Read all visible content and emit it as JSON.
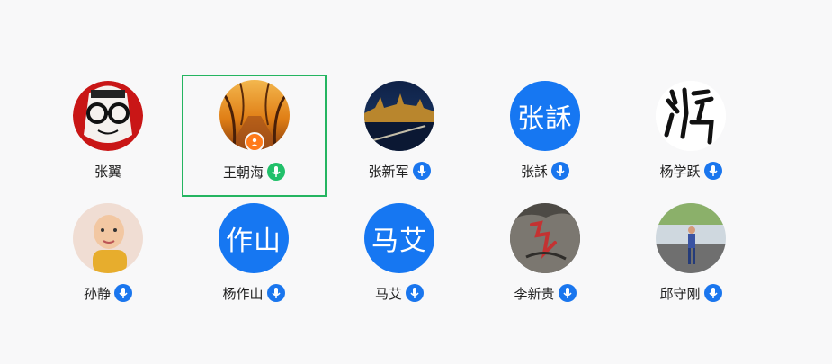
{
  "participants": [
    {
      "name": "张翼",
      "avatar": "cartoon-avatar",
      "mic": null,
      "selected": false
    },
    {
      "name": "王朝海",
      "avatar": "autumn-tree-avatar",
      "mic": "green",
      "selected": true,
      "role_badge": "person-icon"
    },
    {
      "name": "张新军",
      "avatar": "city-night-avatar",
      "mic": "blue",
      "selected": false
    },
    {
      "name": "张訸",
      "avatar_text": "张訸",
      "mic": "blue",
      "selected": false
    },
    {
      "name": "杨学跃",
      "avatar": "calligraphy-avatar",
      "mic": "blue",
      "selected": false
    },
    {
      "name": "孙静",
      "avatar": "baby-photo-avatar",
      "mic": "blue",
      "selected": false
    },
    {
      "name": "杨作山",
      "avatar_text": "作山",
      "mic": "blue",
      "selected": false
    },
    {
      "name": "马艾",
      "avatar_text": "马艾",
      "mic": "blue",
      "selected": false
    },
    {
      "name": "李新贵",
      "avatar": "rock-carving-avatar",
      "mic": "blue",
      "selected": false
    },
    {
      "name": "邱守刚",
      "avatar": "outdoor-person-avatar",
      "mic": "blue",
      "selected": false
    }
  ],
  "colors": {
    "background": "#f8f8f9",
    "text_avatar_bg": "#1677f2",
    "mic_blue": "#1a76ee",
    "mic_green": "#21c06a",
    "selected_border": "#25b561",
    "role_badge": "#ff7a1a"
  }
}
